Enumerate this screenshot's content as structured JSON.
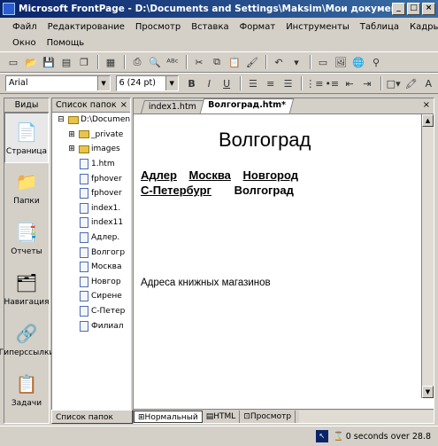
{
  "window": {
    "title": "Microsoft FrontPage - D:\\Documents and Settings\\Maksim\\Мои документы\\Мо..."
  },
  "menu": {
    "row1": [
      "Файл",
      "Редактирование",
      "Просмотр",
      "Вставка",
      "Формат",
      "Инструменты",
      "Таблица",
      "Кадры"
    ],
    "row2": [
      "Окно",
      "Помощь"
    ]
  },
  "format": {
    "font": "Arial",
    "size": "6 (24 pt)"
  },
  "views": {
    "header": "Виды",
    "items": [
      {
        "label": "Страница",
        "icon": "page-icon"
      },
      {
        "label": "Папки",
        "icon": "folder-icon"
      },
      {
        "label": "Отчеты",
        "icon": "reports-icon"
      },
      {
        "label": "Навигация",
        "icon": "navigation-icon"
      },
      {
        "label": "Гиперссылки",
        "icon": "hyperlinks-icon"
      },
      {
        "label": "Задачи",
        "icon": "tasks-icon"
      }
    ]
  },
  "folderlist": {
    "header": "Список папок",
    "tab": "Список папок",
    "items": [
      {
        "name": "D:\\Documen",
        "type": "root"
      },
      {
        "name": "_private",
        "type": "folder"
      },
      {
        "name": "images",
        "type": "folder"
      },
      {
        "name": "1.htm",
        "type": "htm"
      },
      {
        "name": "fphover",
        "type": "htm"
      },
      {
        "name": "fphover",
        "type": "htm"
      },
      {
        "name": "index1.",
        "type": "htm"
      },
      {
        "name": "index11",
        "type": "htm"
      },
      {
        "name": "Адлер.",
        "type": "htm"
      },
      {
        "name": "Волгогр",
        "type": "htm"
      },
      {
        "name": "Москва",
        "type": "htm"
      },
      {
        "name": "Новгор",
        "type": "htm"
      },
      {
        "name": "Сиренe",
        "type": "htm"
      },
      {
        "name": "С-Петер",
        "type": "htm"
      },
      {
        "name": "Филиал",
        "type": "htm"
      }
    ]
  },
  "editor": {
    "tabs": [
      "index1.htm",
      "Волгоград.htm*"
    ],
    "heading": "Волгоград",
    "links_row1": [
      "Адлер",
      "Москва",
      "Новгород"
    ],
    "links_row2": [
      "С-Петербург"
    ],
    "current": "Волгоград",
    "addr": "Адреса книжных магазинов",
    "view_tabs": [
      "Нормальный",
      "HTML",
      "Просмотр"
    ]
  },
  "status": {
    "text": "0 seconds over 28.8"
  }
}
